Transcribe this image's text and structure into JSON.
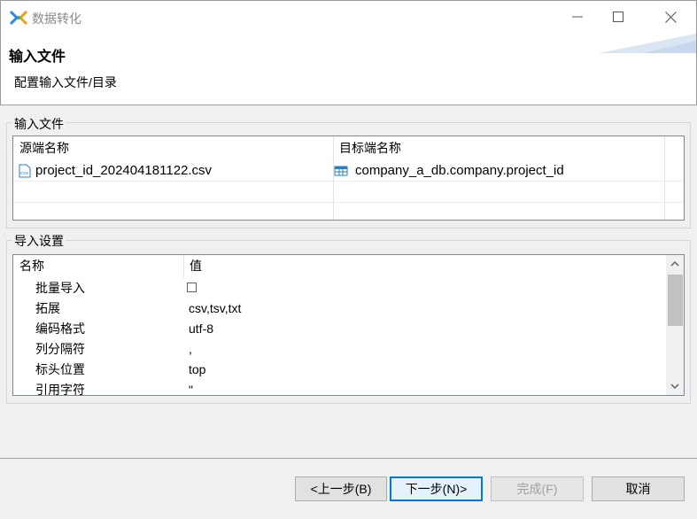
{
  "window": {
    "title": "数据转化",
    "controls": {
      "minimize_icon": "minimize-icon",
      "maximize_icon": "maximize-icon",
      "close_icon": "close-icon"
    }
  },
  "header": {
    "title": "输入文件",
    "description": "配置输入文件/目录"
  },
  "input_files": {
    "group_label": "输入文件",
    "columns": [
      "源端名称",
      "目标端名称"
    ],
    "rows": [
      {
        "source": "project_id_202404181122.csv",
        "source_icon": "csv-file-icon",
        "target": "company_a_db.company.project_id",
        "target_icon": "table-icon"
      }
    ]
  },
  "import_settings": {
    "group_label": "导入设置",
    "columns": [
      "名称",
      "值"
    ],
    "rows": [
      {
        "name": "批量导入",
        "value": "",
        "type": "checkbox",
        "checked": false
      },
      {
        "name": "拓展",
        "value": "csv,tsv,txt"
      },
      {
        "name": "编码格式",
        "value": "utf-8"
      },
      {
        "name": "列分隔符",
        "value": ","
      },
      {
        "name": "标头位置",
        "value": "top"
      },
      {
        "name": "引用字符",
        "value": "\""
      }
    ]
  },
  "buttons": {
    "back": "<上一步(B)",
    "next": "下一步(N)>",
    "finish": "完成(F)",
    "cancel": "取消"
  },
  "colors": {
    "accent": "#0078d7",
    "checkbox_border": "#1a6fb5"
  }
}
